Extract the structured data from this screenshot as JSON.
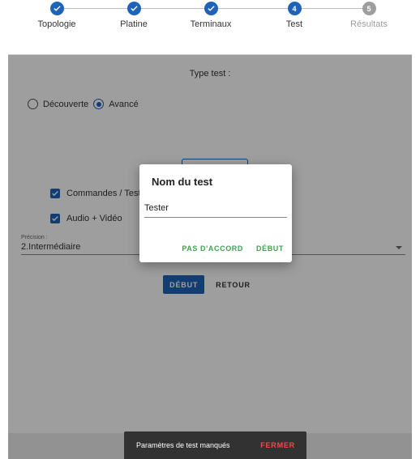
{
  "stepper": {
    "steps": [
      {
        "label": "Topologie",
        "state": "done",
        "number": ""
      },
      {
        "label": "Platine",
        "state": "done",
        "number": ""
      },
      {
        "label": "Terminaux",
        "state": "done",
        "number": ""
      },
      {
        "label": "Test",
        "state": "active",
        "number": "4"
      },
      {
        "label": "Résultats",
        "state": "pending",
        "number": "5"
      }
    ]
  },
  "main": {
    "type_label": "Type test :",
    "radios": [
      {
        "label": "Découverte",
        "checked": false
      },
      {
        "label": "Avancé",
        "checked": true
      }
    ],
    "checkboxes": [
      {
        "label": "Commandes / Test",
        "checked": true
      },
      {
        "label": "Audio + Vidéo",
        "checked": true
      }
    ],
    "precision": {
      "caption": "Précision :",
      "value": "2.Intermédiaire"
    },
    "buttons": {
      "start": "DÉBUT",
      "back": "RETOUR"
    }
  },
  "dialog": {
    "title": "Nom du test",
    "input_value": "Tester",
    "cancel_label": "PAS D'ACCORD",
    "confirm_label": "DÉBUT"
  },
  "snackbar": {
    "message": "Paramètres de test manqués",
    "action": "FERMER"
  },
  "colors": {
    "primary": "#1e63b8",
    "dialog_action": "#3fa34d",
    "snackbar_action": "#ef4a4a"
  }
}
